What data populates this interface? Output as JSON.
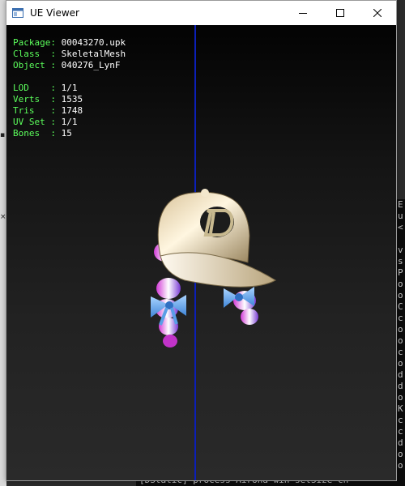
{
  "colors": {
    "info_label": "#5cff5c",
    "info_value": "#ffffff",
    "axis_line": "#0b1fb8"
  },
  "window": {
    "title": "UE Viewer",
    "icon": "window-app-icon",
    "controls": [
      "minimize-icon",
      "maximize-icon",
      "close-icon"
    ]
  },
  "info": {
    "package": {
      "label": "Package: ",
      "value": "00043270.upk"
    },
    "class": {
      "label": "Class  : ",
      "value": "SkeletalMesh"
    },
    "object": {
      "label": "Object : ",
      "value": "040276_LynF"
    },
    "lod": {
      "label": "LOD    : ",
      "value": "1/1"
    },
    "verts": {
      "label": "Verts  : ",
      "value": "1535"
    },
    "tris": {
      "label": "Tris   : ",
      "value": "1748"
    },
    "uvset": {
      "label": "UV Set : ",
      "value": "1/1"
    },
    "bones": {
      "label": "Bones  : ",
      "value": "15"
    }
  },
  "console_bottom": "[DStatic] process  Airona win setSize  ch"
}
